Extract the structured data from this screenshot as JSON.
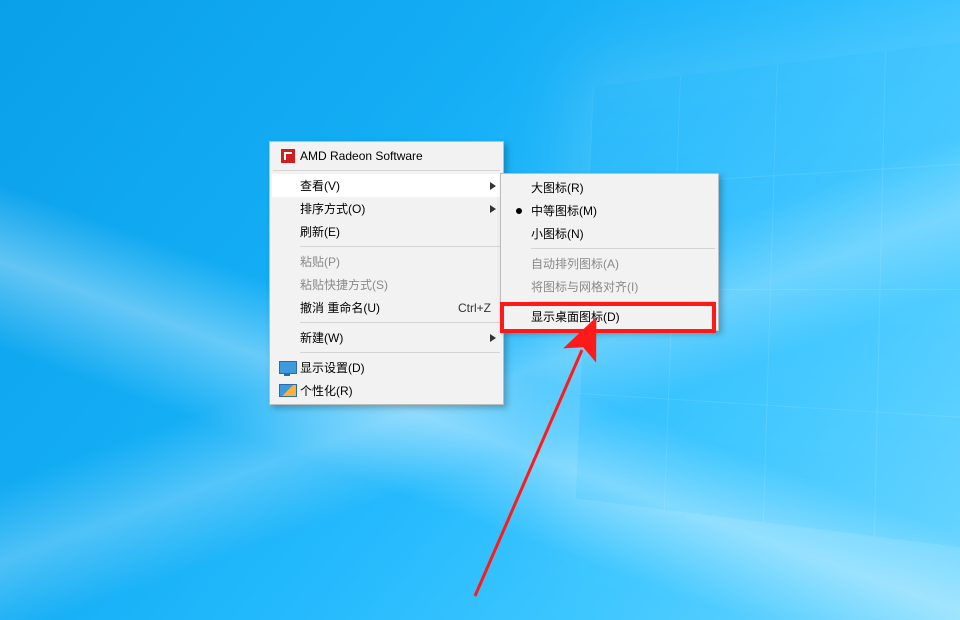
{
  "main_menu": {
    "amd": {
      "label": "AMD Radeon Software"
    },
    "view": {
      "label": "查看(V)"
    },
    "sort": {
      "label": "排序方式(O)"
    },
    "refresh": {
      "label": "刷新(E)"
    },
    "paste": {
      "label": "粘贴(P)"
    },
    "paste_shortcut": {
      "label": "粘贴快捷方式(S)"
    },
    "undo": {
      "label": "撤消 重命名(U)",
      "accel": "Ctrl+Z"
    },
    "new": {
      "label": "新建(W)"
    },
    "display": {
      "label": "显示设置(D)"
    },
    "personalize": {
      "label": "个性化(R)"
    }
  },
  "view_submenu": {
    "large_icons": {
      "label": "大图标(R)"
    },
    "medium_icons": {
      "label": "中等图标(M)"
    },
    "small_icons": {
      "label": "小图标(N)"
    },
    "auto_arrange": {
      "label": "自动排列图标(A)"
    },
    "align_grid": {
      "label": "将图标与网格对齐(I)"
    },
    "show_icons": {
      "label": "显示桌面图标(D)"
    }
  },
  "arrow_glyph": "▶"
}
